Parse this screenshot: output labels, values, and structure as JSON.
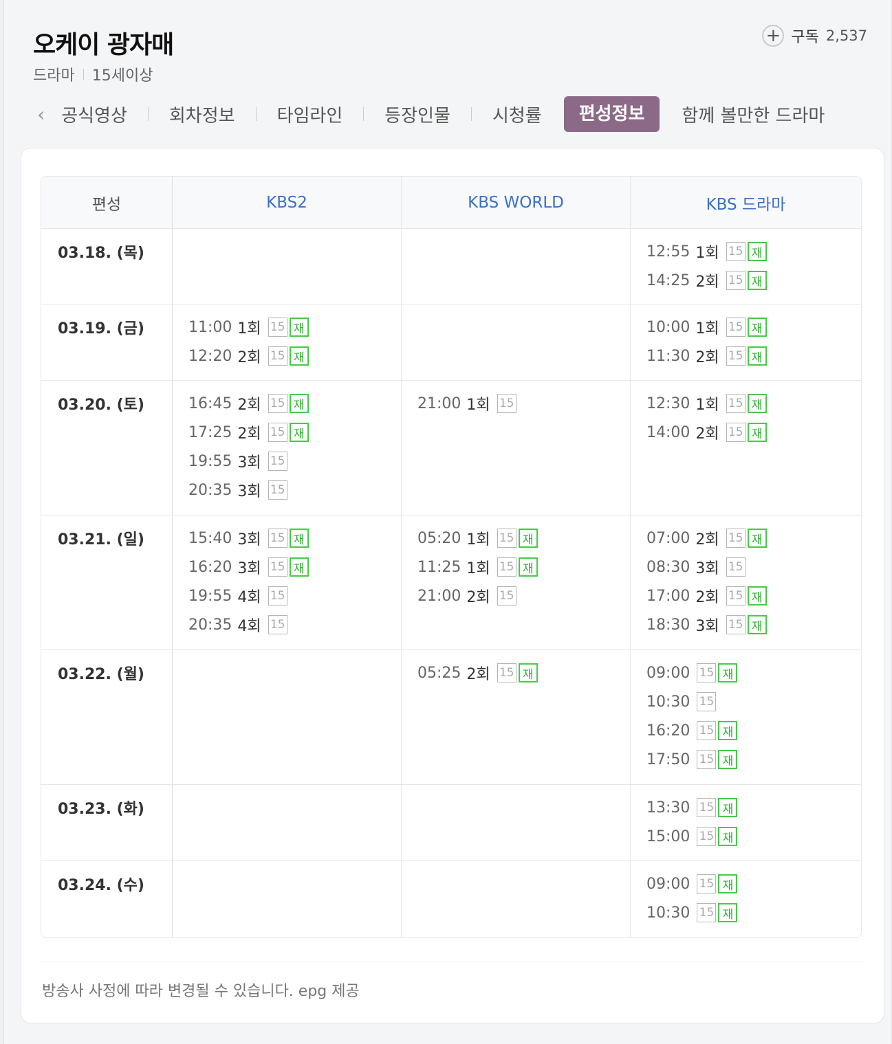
{
  "program": {
    "title": "오케이 광자매",
    "genre": "드라마",
    "rating": "15세이상",
    "subscribe_label": "구독",
    "subscribe_count": "2,537"
  },
  "tabs": [
    "공식영상",
    "회차정보",
    "타임라인",
    "등장인물",
    "시청률",
    "편성정보",
    "함께 볼만한 드라마"
  ],
  "active_tab": "편성정보",
  "schedule": {
    "corner_label": "편성",
    "channels": [
      "KBS2",
      "KBS WORLD",
      "KBS 드라마"
    ],
    "rows": [
      {
        "date": "03.18. (목)",
        "cells": [
          [],
          [],
          [
            {
              "time": "12:55",
              "ep": "1회",
              "age": "15",
              "rerun": "재"
            },
            {
              "time": "14:25",
              "ep": "2회",
              "age": "15",
              "rerun": "재"
            }
          ]
        ]
      },
      {
        "date": "03.19. (금)",
        "cells": [
          [
            {
              "time": "11:00",
              "ep": "1회",
              "age": "15",
              "rerun": "재"
            },
            {
              "time": "12:20",
              "ep": "2회",
              "age": "15",
              "rerun": "재"
            }
          ],
          [],
          [
            {
              "time": "10:00",
              "ep": "1회",
              "age": "15",
              "rerun": "재"
            },
            {
              "time": "11:30",
              "ep": "2회",
              "age": "15",
              "rerun": "재"
            }
          ]
        ]
      },
      {
        "date": "03.20. (토)",
        "cells": [
          [
            {
              "time": "16:45",
              "ep": "2회",
              "age": "15",
              "rerun": "재"
            },
            {
              "time": "17:25",
              "ep": "2회",
              "age": "15",
              "rerun": "재"
            },
            {
              "time": "19:55",
              "ep": "3회",
              "age": "15"
            },
            {
              "time": "20:35",
              "ep": "3회",
              "age": "15"
            }
          ],
          [
            {
              "time": "21:00",
              "ep": "1회",
              "age": "15"
            }
          ],
          [
            {
              "time": "12:30",
              "ep": "1회",
              "age": "15",
              "rerun": "재"
            },
            {
              "time": "14:00",
              "ep": "2회",
              "age": "15",
              "rerun": "재"
            }
          ]
        ]
      },
      {
        "date": "03.21. (일)",
        "cells": [
          [
            {
              "time": "15:40",
              "ep": "3회",
              "age": "15",
              "rerun": "재"
            },
            {
              "time": "16:20",
              "ep": "3회",
              "age": "15",
              "rerun": "재"
            },
            {
              "time": "19:55",
              "ep": "4회",
              "age": "15"
            },
            {
              "time": "20:35",
              "ep": "4회",
              "age": "15"
            }
          ],
          [
            {
              "time": "05:20",
              "ep": "1회",
              "age": "15",
              "rerun": "재"
            },
            {
              "time": "11:25",
              "ep": "1회",
              "age": "15",
              "rerun": "재"
            },
            {
              "time": "21:00",
              "ep": "2회",
              "age": "15"
            }
          ],
          [
            {
              "time": "07:00",
              "ep": "2회",
              "age": "15",
              "rerun": "재"
            },
            {
              "time": "08:30",
              "ep": "3회",
              "age": "15"
            },
            {
              "time": "17:00",
              "ep": "2회",
              "age": "15",
              "rerun": "재"
            },
            {
              "time": "18:30",
              "ep": "3회",
              "age": "15",
              "rerun": "재"
            }
          ]
        ]
      },
      {
        "date": "03.22. (월)",
        "cells": [
          [],
          [
            {
              "time": "05:25",
              "ep": "2회",
              "age": "15",
              "rerun": "재"
            }
          ],
          [
            {
              "time": "09:00",
              "age": "15",
              "rerun": "재"
            },
            {
              "time": "10:30",
              "age": "15"
            },
            {
              "time": "16:20",
              "age": "15",
              "rerun": "재"
            },
            {
              "time": "17:50",
              "age": "15",
              "rerun": "재"
            }
          ]
        ]
      },
      {
        "date": "03.23. (화)",
        "cells": [
          [],
          [],
          [
            {
              "time": "13:30",
              "age": "15",
              "rerun": "재"
            },
            {
              "time": "15:00",
              "age": "15",
              "rerun": "재"
            }
          ]
        ]
      },
      {
        "date": "03.24. (수)",
        "cells": [
          [],
          [],
          [
            {
              "time": "09:00",
              "age": "15",
              "rerun": "재"
            },
            {
              "time": "10:30",
              "age": "15",
              "rerun": "재"
            }
          ]
        ]
      }
    ]
  },
  "footer_note": "방송사 사정에 따라 변경될 수 있습니다. epg 제공"
}
